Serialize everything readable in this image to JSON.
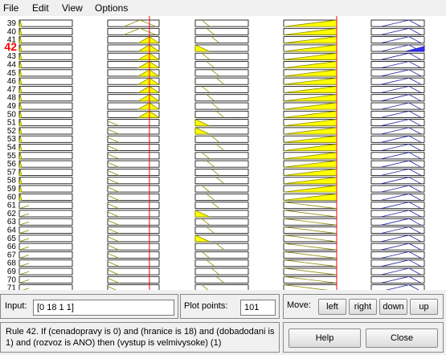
{
  "menu": {
    "file": "File",
    "edit": "Edit",
    "view": "View",
    "options": "Options"
  },
  "plot": {
    "row_numbers": [
      39,
      40,
      41,
      42,
      43,
      44,
      45,
      46,
      47,
      48,
      49,
      50,
      51,
      52,
      53,
      54,
      55,
      56,
      57,
      58,
      59,
      60,
      61,
      62,
      63,
      64,
      65,
      66,
      67,
      68,
      69,
      70,
      71
    ],
    "selected_rule": "42",
    "fill_color": "#ffff00",
    "output_fill_color": "#3030ff",
    "cursor_color": "#ff0000"
  },
  "input": {
    "label": "Input:",
    "value": "[0 18 1 1]"
  },
  "plot_points": {
    "label": "Plot points:",
    "value": "101"
  },
  "move": {
    "label": "Move:",
    "left": "left",
    "right": "right",
    "down": "down",
    "up": "up"
  },
  "rule_text": "Rule 42. If (cenadopravy is 0) and (hranice is 18) and (dobadodani is 1) and (rozvoz is ANO) then (vystup is velmivysoke) (1)",
  "buttons": {
    "help": "Help",
    "close": "Close"
  }
}
